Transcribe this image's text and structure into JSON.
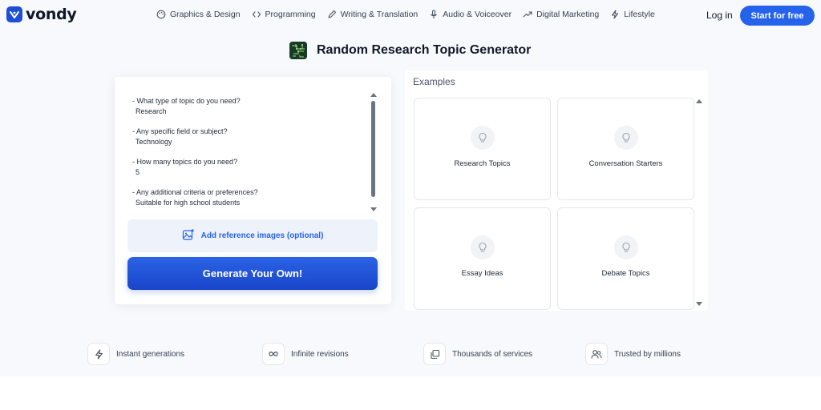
{
  "brand": {
    "name": "vondy",
    "color": "#2563eb"
  },
  "nav": {
    "items": [
      {
        "label": "Graphics & Design",
        "icon": "palette-icon"
      },
      {
        "label": "Programming",
        "icon": "code-icon"
      },
      {
        "label": "Writing & Translation",
        "icon": "pen-icon"
      },
      {
        "label": "Audio & Voiceover",
        "icon": "microphone-icon"
      },
      {
        "label": "Digital Marketing",
        "icon": "trend-up-icon"
      },
      {
        "label": "Lifestyle",
        "icon": "lightning-icon"
      }
    ],
    "login_label": "Log in",
    "start_label": "Start for free"
  },
  "page": {
    "title": "Random Research Topic Generator"
  },
  "form": {
    "qa": [
      {
        "question": "- What type of topic do you need?",
        "answer": "Research"
      },
      {
        "question": "- Any specific field or subject?",
        "answer": "Technology"
      },
      {
        "question": "- How many topics do you need?",
        "answer": "5"
      },
      {
        "question": "- Any additional criteria or preferences?",
        "answer": "Suitable for high school students"
      }
    ],
    "reference_label": "Add reference images (optional)",
    "generate_label": "Generate Your Own!"
  },
  "examples": {
    "heading": "Examples",
    "items": [
      {
        "label": "Research Topics",
        "icon": "lightbulb-icon"
      },
      {
        "label": "Conversation Starters",
        "icon": "lightbulb-icon"
      },
      {
        "label": "Essay Ideas",
        "icon": "lightbulb-icon"
      },
      {
        "label": "Debate Topics",
        "icon": "lightbulb-icon"
      }
    ]
  },
  "features": [
    {
      "label": "Instant generations",
      "icon": "lightning-icon"
    },
    {
      "label": "Infinite revisions",
      "icon": "infinity-icon"
    },
    {
      "label": "Thousands of services",
      "icon": "stack-icon"
    },
    {
      "label": "Trusted by millions",
      "icon": "users-icon"
    }
  ]
}
